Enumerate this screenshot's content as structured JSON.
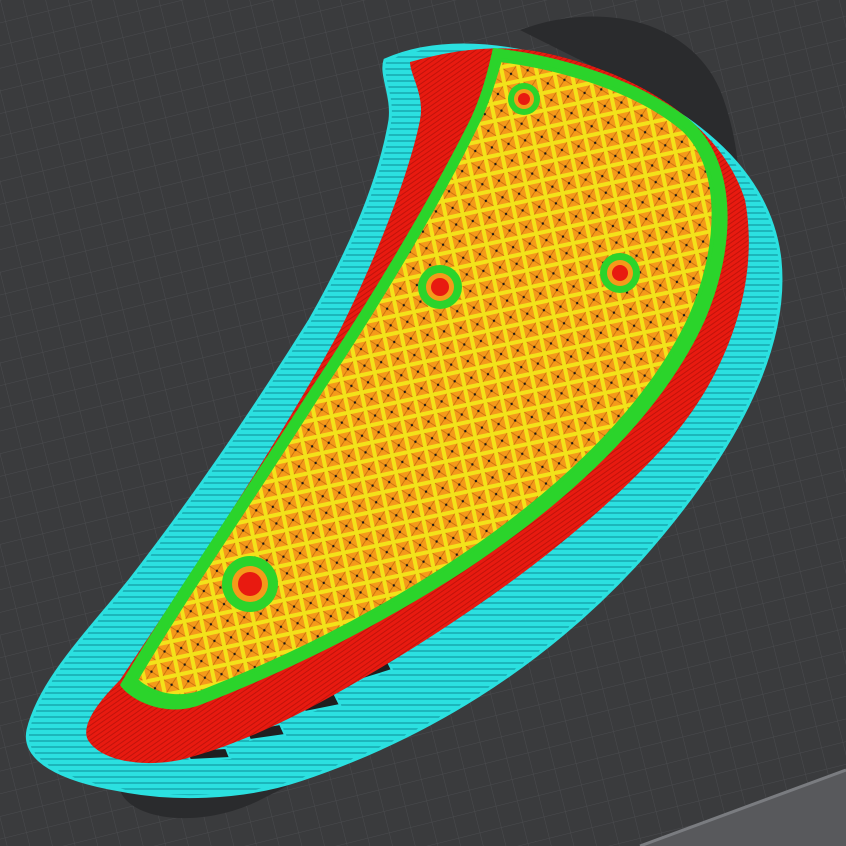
{
  "scene": {
    "kind": "3d-print-slicer-preview",
    "colors": {
      "bed_background": "#3a3b3d",
      "bed_grid_line": "#4a4b4e",
      "bed_edge_highlight": "#7a7c80",
      "shadow": "#2a2b2d",
      "skirt": "#2be0e0",
      "skirt_line": "#0e8c96",
      "outer_wall": "#e81a10",
      "inner_wall": "#2bd42b",
      "infill": "#f59a1a",
      "infill_line": "#c26a0c",
      "infill_gap": "#f3e21a",
      "support": "#2be0e0"
    },
    "holes": [
      {
        "name": "hole-top"
      },
      {
        "name": "hole-middle-left"
      },
      {
        "name": "hole-middle-right"
      },
      {
        "name": "hole-bottom"
      }
    ]
  }
}
